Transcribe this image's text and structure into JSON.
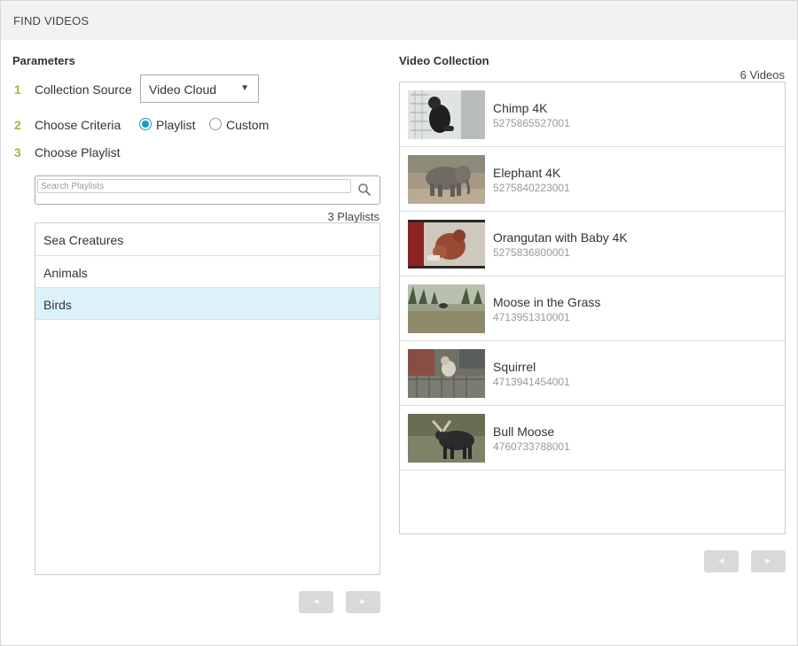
{
  "header": {
    "title": "FIND VIDEOS"
  },
  "parameters": {
    "title": "Parameters",
    "steps": [
      {
        "num": "1",
        "label": "Collection Source"
      },
      {
        "num": "2",
        "label": "Choose Criteria"
      },
      {
        "num": "3",
        "label": "Choose Playlist"
      }
    ],
    "collection_source": {
      "selected": "Video Cloud"
    },
    "criteria": [
      {
        "label": "Playlist",
        "checked": true
      },
      {
        "label": "Custom",
        "checked": false
      }
    ],
    "search": {
      "placeholder": "Search Playlists",
      "value": ""
    },
    "playlist_count": "3 Playlists",
    "playlists": [
      {
        "label": "Sea Creatures",
        "selected": false
      },
      {
        "label": "Animals",
        "selected": false
      },
      {
        "label": "Birds",
        "selected": true
      }
    ],
    "pagination": {
      "prev_icon": "prev-arrow-icon",
      "next_icon": "next-arrow-icon"
    }
  },
  "collection": {
    "title": "Video Collection",
    "count": "6 Videos",
    "videos": [
      {
        "name": "Chimp 4K",
        "id": "5275865527001",
        "thumb_icon": "chimp-thumbnail"
      },
      {
        "name": "Elephant 4K",
        "id": "5275840223001",
        "thumb_icon": "elephant-thumbnail"
      },
      {
        "name": "Orangutan with Baby 4K",
        "id": "5275836800001",
        "thumb_icon": "orangutan-thumbnail"
      },
      {
        "name": "Moose in the Grass",
        "id": "4713951310001",
        "thumb_icon": "moose-thumbnail"
      },
      {
        "name": "Squirrel",
        "id": "4713941454001",
        "thumb_icon": "squirrel-thumbnail"
      },
      {
        "name": "Bull Moose",
        "id": "4760733788001",
        "thumb_icon": "bull-moose-thumbnail"
      }
    ]
  },
  "colors": {
    "header_bg": "#f2f2f2",
    "step_number": "#9bbb3a",
    "radio_accent": "#1a9bbf",
    "selected_row": "#dcf2fa",
    "pager_button": "#d9d9d9"
  }
}
